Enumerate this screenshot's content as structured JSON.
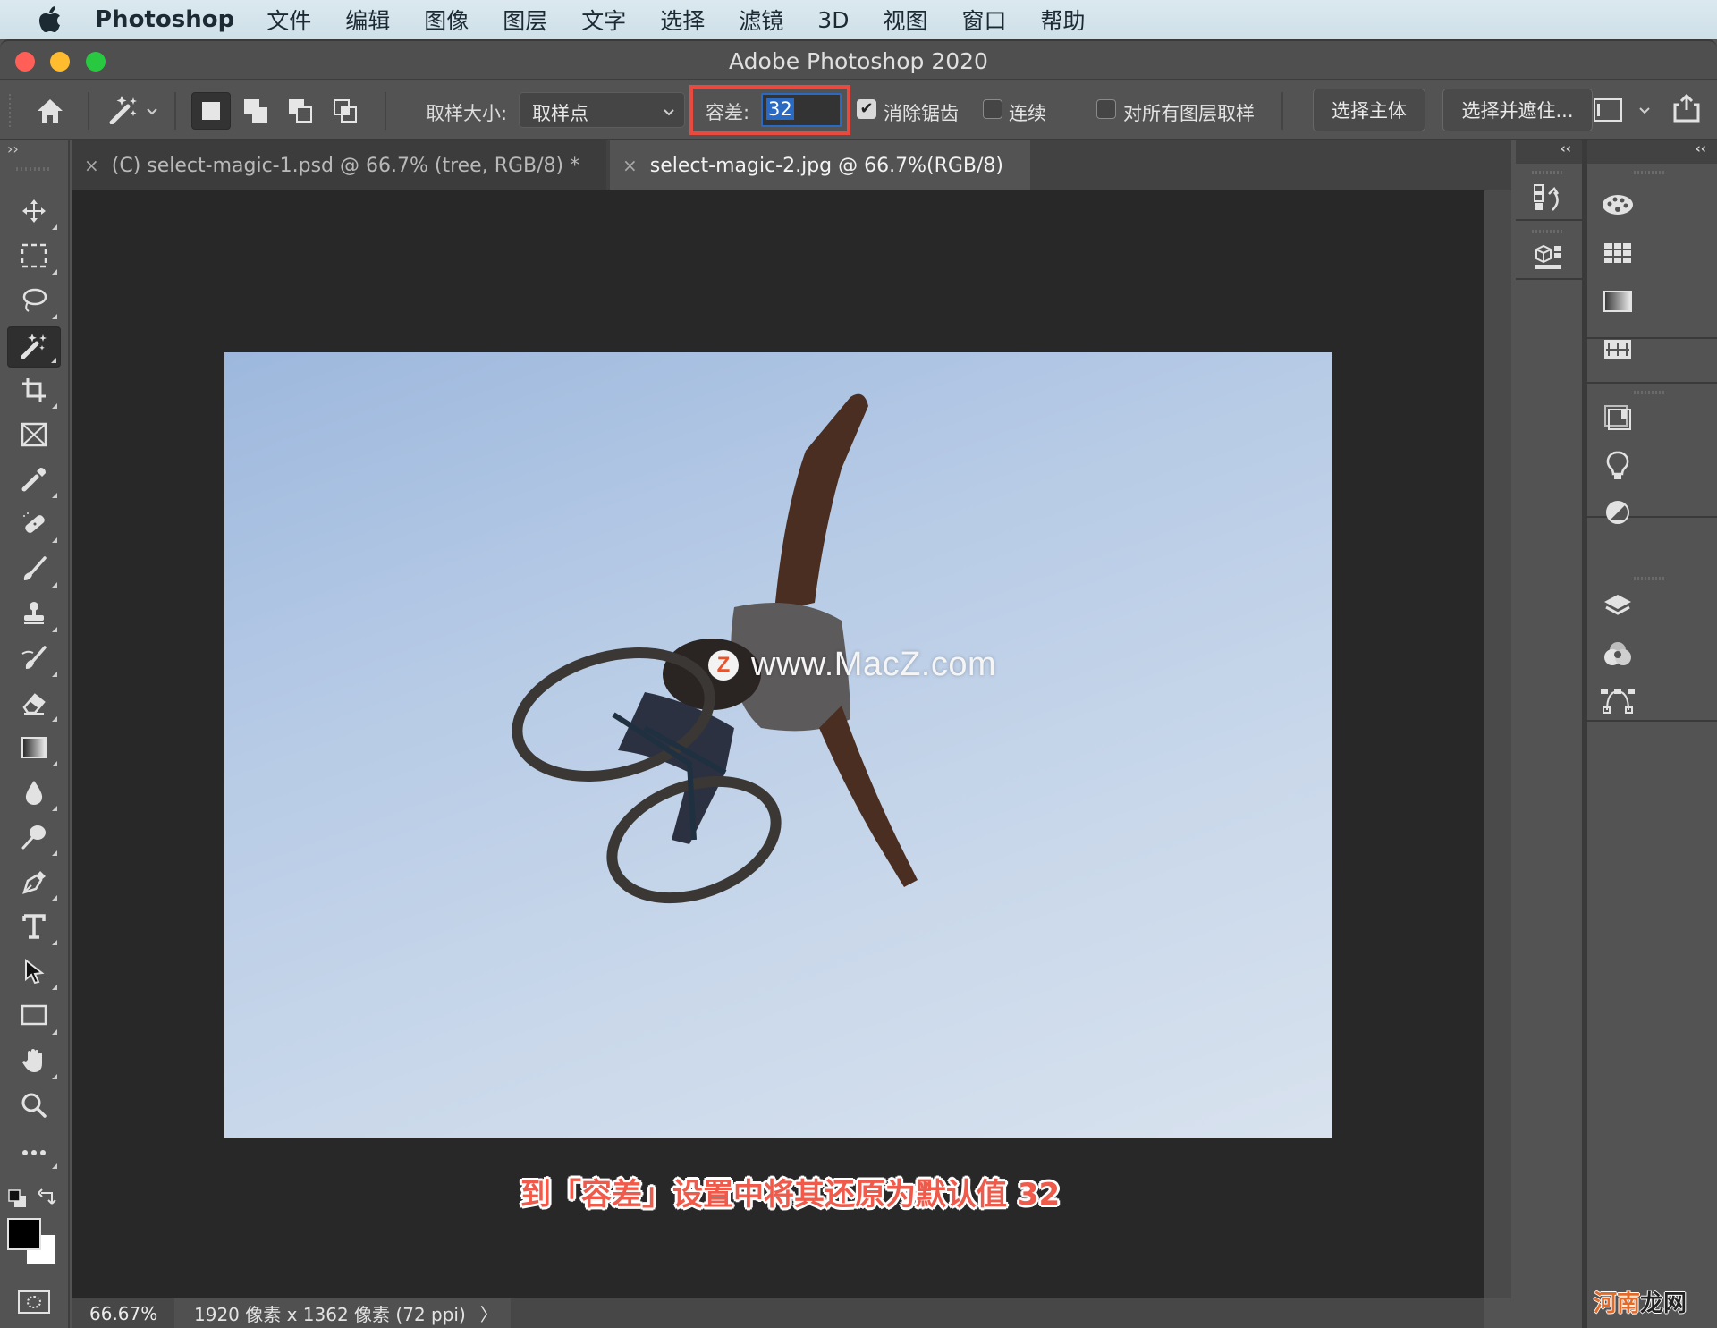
{
  "menubar": {
    "app_name": "Photoshop",
    "items": [
      "文件",
      "编辑",
      "图像",
      "图层",
      "文字",
      "选择",
      "滤镜",
      "3D",
      "视图",
      "窗口",
      "帮助"
    ]
  },
  "window": {
    "title": "Adobe Photoshop 2020"
  },
  "options": {
    "sample_size_label": "取样大小:",
    "sample_size_value": "取样点",
    "tolerance_label": "容差:",
    "tolerance_value": "32",
    "anti_alias_label": "消除锯齿",
    "anti_alias_checked": true,
    "contiguous_label": "连续",
    "contiguous_checked": false,
    "sample_all_layers_label": "对所有图层取样",
    "sample_all_layers_checked": false,
    "select_subject_label": "选择主体",
    "select_and_mask_label": "选择并遮住...",
    "highlight_color": "#e9493f"
  },
  "tabs": [
    {
      "label": "(C) select-magic-1.psd @ 66.7% (tree, RGB/8) *",
      "active": false
    },
    {
      "label": "select-magic-2.jpg @ 66.7%(RGB/8)",
      "active": true
    }
  ],
  "toolbox": {
    "collapse_glyph": "››",
    "tools": [
      {
        "name": "move-tool",
        "icon": "move-icon"
      },
      {
        "name": "rectangular-marquee-tool",
        "icon": "marquee-icon"
      },
      {
        "name": "lasso-tool",
        "icon": "lasso-icon"
      },
      {
        "name": "magic-wand-tool",
        "icon": "magic-wand-icon",
        "active": true
      },
      {
        "name": "crop-tool",
        "icon": "crop-icon"
      },
      {
        "name": "frame-tool",
        "icon": "frame-icon"
      },
      {
        "name": "eyedropper-tool",
        "icon": "eyedropper-icon"
      },
      {
        "name": "spot-healing-tool",
        "icon": "bandage-icon"
      },
      {
        "name": "brush-tool",
        "icon": "brush-icon"
      },
      {
        "name": "clone-stamp-tool",
        "icon": "stamp-icon"
      },
      {
        "name": "history-brush-tool",
        "icon": "history-brush-icon"
      },
      {
        "name": "eraser-tool",
        "icon": "eraser-icon"
      },
      {
        "name": "gradient-tool",
        "icon": "gradient-icon"
      },
      {
        "name": "blur-tool",
        "icon": "drop-icon"
      },
      {
        "name": "dodge-tool",
        "icon": "dodge-icon"
      },
      {
        "name": "pen-tool",
        "icon": "pen-icon"
      },
      {
        "name": "type-tool",
        "icon": "type-icon"
      },
      {
        "name": "path-selection-tool",
        "icon": "arrow-icon"
      },
      {
        "name": "rectangle-tool",
        "icon": "rectangle-icon"
      },
      {
        "name": "hand-tool",
        "icon": "hand-icon"
      },
      {
        "name": "zoom-tool",
        "icon": "zoom-icon"
      },
      {
        "name": "edit-toolbar",
        "icon": "more-icon"
      }
    ],
    "foreground_color": "#000000",
    "background_color": "#ffffff"
  },
  "canvas": {
    "watermark_logo": "Z",
    "watermark_text": "www.MacZ.com",
    "caption": "到「容差」设置中将其还原为默认值 32",
    "caption_color": "#f05a4a"
  },
  "status": {
    "zoom": "66.67%",
    "info": "1920 像素 x 1362 像素 (72 ppi)",
    "arrow": "〉"
  },
  "panels": {
    "collapse_glyph": "‹‹",
    "column1": [
      "history-icon",
      "3d-icon"
    ],
    "column2_group1": [
      "color-icon",
      "swatches-icon",
      "gradients-icon",
      "patterns-icon"
    ],
    "column2_group2": [
      "libraries-icon",
      "learn-icon",
      "adjustments-icon"
    ],
    "column2_group3": [
      "layers-icon",
      "channels-icon",
      "paths-icon"
    ]
  },
  "corner_watermark": {
    "part1": "河南",
    "part2": "龙网"
  }
}
